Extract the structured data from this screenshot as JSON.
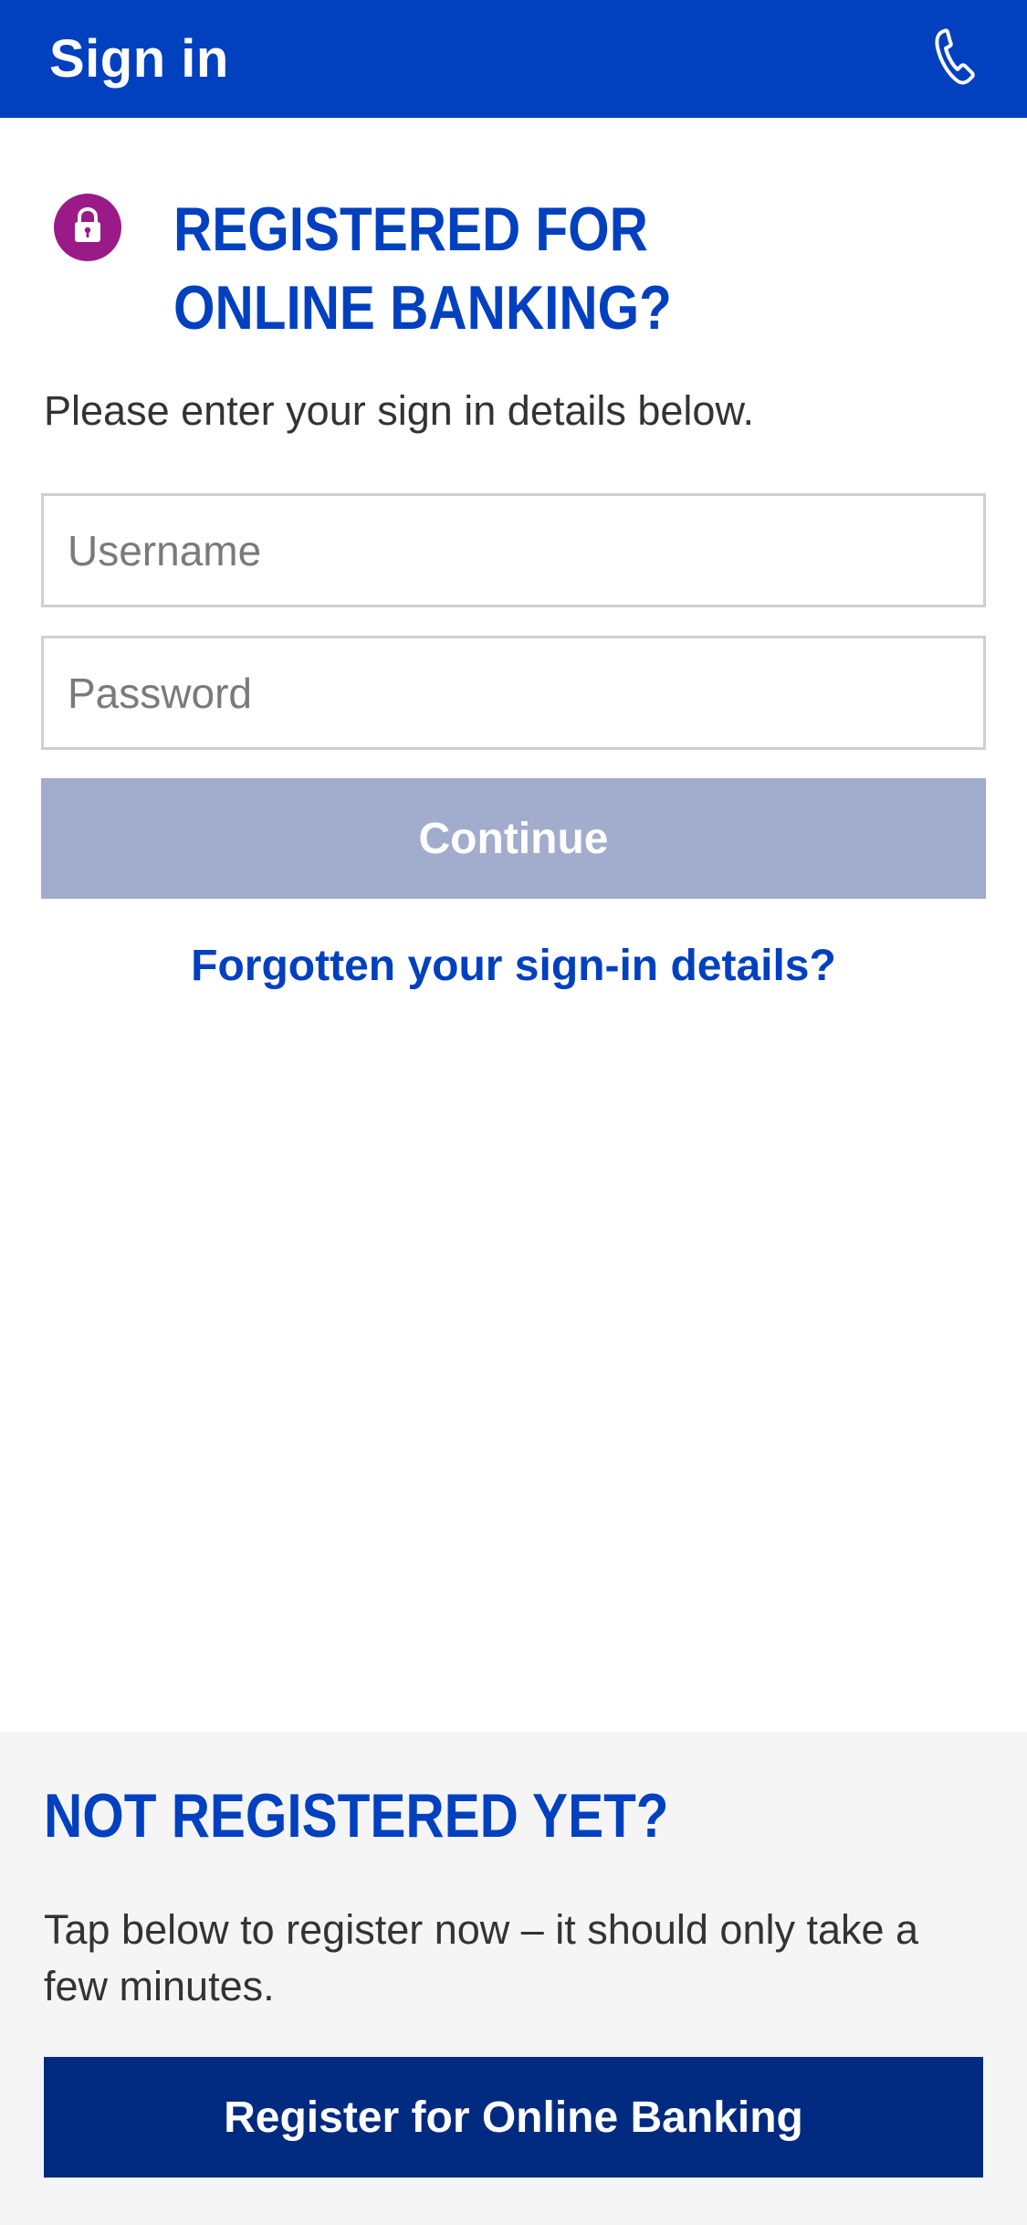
{
  "header": {
    "title": "Sign in",
    "phone_icon": "phone-icon"
  },
  "registered": {
    "title_line1": "REGISTERED FOR",
    "title_line2": "ONLINE BANKING?",
    "subtitle": "Please enter your sign in details below.",
    "lock_icon": "lock-icon",
    "username_placeholder": "Username",
    "password_placeholder": "Password",
    "continue_label": "Continue",
    "forgot_label": "Forgotten your sign-in details?"
  },
  "not_registered": {
    "title": "NOT REGISTERED YET?",
    "text": "Tap below to register now – it should only take a few minutes.",
    "register_label": "Register for Online Banking"
  },
  "colors": {
    "brand_blue": "#0140bf",
    "navy_button": "#002a80",
    "disabled_button": "#a2accd",
    "lock_badge": "#9a1a88"
  }
}
